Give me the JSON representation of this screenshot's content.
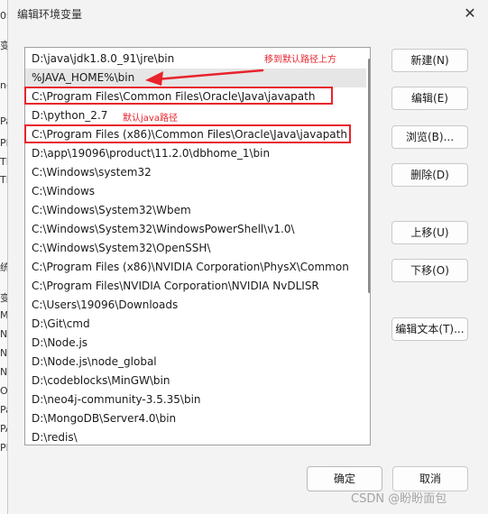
{
  "background_fragments": [
    "09",
    "变",
    "nd",
    "Pa",
    "PF",
    "TE",
    "TN",
    "统",
    "变",
    "Mi",
    "NI",
    "NI",
    "NI",
    "OS",
    "Pa",
    "PA",
    "PF"
  ],
  "dialog": {
    "title": "编辑环境变量",
    "close_glyph": "✕"
  },
  "path_list": {
    "items": [
      "D:\\java\\jdk1.8.0_91\\jre\\bin",
      "%JAVA_HOME%\\bin",
      "C:\\Program Files\\Common Files\\Oracle\\Java\\javapath",
      "D:\\python_2.7",
      "C:\\Program Files (x86)\\Common Files\\Oracle\\Java\\javapath",
      "D:\\app\\19096\\product\\11.2.0\\dbhome_1\\bin",
      "C:\\Windows\\system32",
      "C:\\Windows",
      "C:\\Windows\\System32\\Wbem",
      "C:\\Windows\\System32\\WindowsPowerShell\\v1.0\\",
      "C:\\Windows\\System32\\OpenSSH\\",
      "C:\\Program Files (x86)\\NVIDIA Corporation\\PhysX\\Common",
      "C:\\Program Files\\NVIDIA Corporation\\NVIDIA NvDLISR",
      "C:\\Users\\19096\\Downloads",
      "D:\\Git\\cmd",
      "D:\\Node.js",
      "D:\\Node.js\\node_global",
      "D:\\codeblocks\\MinGW\\bin",
      "D:\\neo4j-community-3.5.35\\bin",
      "D:\\MongoDB\\Server4.0\\bin",
      "D:\\redis\\"
    ],
    "selected_index": 1
  },
  "annotations": {
    "move_up_note": "移到默认路径上方",
    "default_java_note": "默认java路径",
    "color": "#e8232b"
  },
  "buttons": {
    "new": "新建(N)",
    "edit": "编辑(E)",
    "browse": "浏览(B)...",
    "delete": "删除(D)",
    "move_up": "上移(U)",
    "move_down": "下移(O)",
    "edit_text": "编辑文本(T)...",
    "ok": "确定",
    "cancel": "取消"
  },
  "watermark": "CSDN @盼盼面包"
}
